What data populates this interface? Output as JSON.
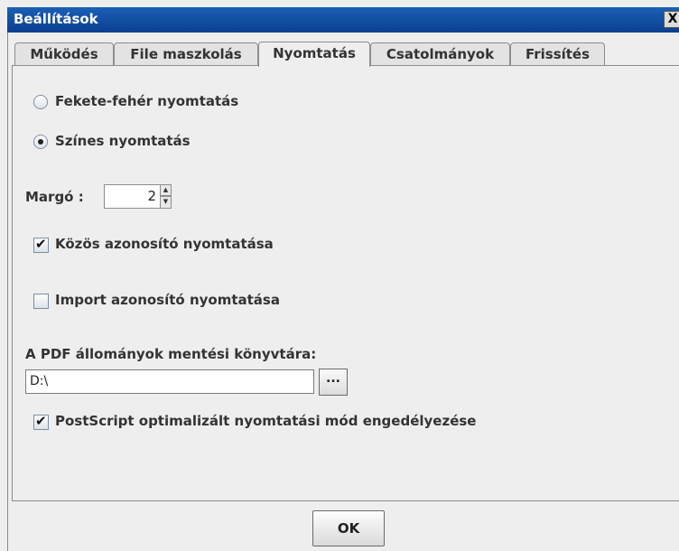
{
  "window": {
    "title": "Beállítások",
    "close_label": "X"
  },
  "tabs": [
    {
      "label": "Működés",
      "active": false
    },
    {
      "label": "File maszkolás",
      "active": false
    },
    {
      "label": "Nyomtatás",
      "active": true
    },
    {
      "label": "Csatolmányok",
      "active": false
    },
    {
      "label": "Frissítés",
      "active": false
    }
  ],
  "print_mode": {
    "options": [
      {
        "label": "Fekete-fehér nyomtatás",
        "selected": false
      },
      {
        "label": "Színes nyomtatás",
        "selected": true
      }
    ]
  },
  "margin": {
    "label": "Margó :",
    "value": "2",
    "up_icon": "arrow-up-icon",
    "down_icon": "arrow-down-icon"
  },
  "checkboxes": {
    "common_id": {
      "label": "Közös azonosító nyomtatása",
      "checked": true
    },
    "import_id": {
      "label": "Import azonosító nyomtatása",
      "checked": false
    },
    "postscript": {
      "label": "PostScript optimalizált nyomtatási mód engedélyezése",
      "checked": true
    }
  },
  "pdf_dir": {
    "label": "A PDF állományok mentési könyvtára:",
    "value": "D:\\",
    "browse_label": "..."
  },
  "footer": {
    "ok_label": "OK"
  }
}
